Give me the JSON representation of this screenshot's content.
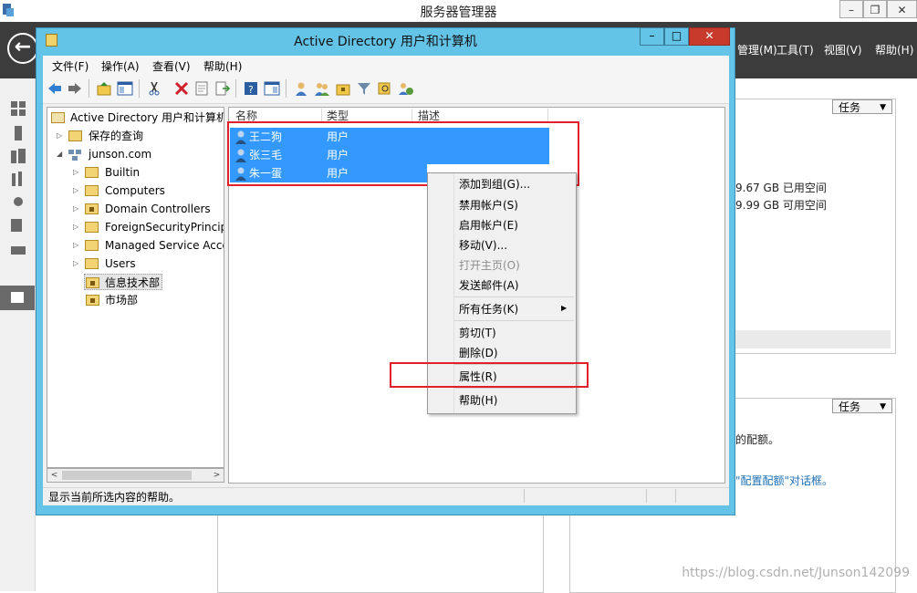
{
  "server_manager": {
    "title": "服务器管理器",
    "menus": [
      "管理(M)",
      "工具(T)",
      "视图(V)",
      "帮助(H)"
    ],
    "task_button": "任务",
    "disk_used": "9.67 GB 已用空间",
    "disk_free": "9.99 GB 可用空间",
    "quota_text_1": "的配额。",
    "quota_text_2": "\"配置配额\"对话框。"
  },
  "ad_window": {
    "title": "Active Directory 用户和计算机",
    "menus": [
      "文件(F)",
      "操作(A)",
      "查看(V)",
      "帮助(H)"
    ],
    "toolbar_icons": [
      "back-icon",
      "forward-icon",
      "up-folder-icon",
      "show-tree-icon",
      "cut-icon",
      "delete-icon",
      "properties-icon",
      "export-icon",
      "help-icon",
      "help-pane-icon",
      "new-user-icon",
      "new-group-icon",
      "new-ou-icon",
      "filter-icon",
      "find-icon",
      "add-to-group-icon"
    ],
    "tree": {
      "root": "Active Directory 用户和计算机",
      "saved_queries": "保存的查询",
      "domain": "junson.com",
      "children": [
        "Builtin",
        "Computers",
        "Domain Controllers",
        "ForeignSecurityPrincipals",
        "Managed Service Accounts",
        "Users",
        "信息技术部",
        "市场部"
      ]
    },
    "list": {
      "columns": [
        "名称",
        "类型",
        "描述"
      ],
      "rows": [
        {
          "name": "王二狗",
          "type": "用户"
        },
        {
          "name": "张三毛",
          "type": "用户"
        },
        {
          "name": "朱一蛋",
          "type": "用户"
        }
      ]
    },
    "status": "显示当前所选内容的帮助。"
  },
  "context_menu": {
    "items": [
      "添加到组(G)...",
      "禁用帐户(S)",
      "启用帐户(E)",
      "移动(V)...",
      "打开主页(O)",
      "发送邮件(A)",
      "所有任务(K)",
      "剪切(T)",
      "删除(D)",
      "属性(R)",
      "帮助(H)"
    ],
    "disabled": [
      "打开主页(O)"
    ]
  },
  "colors": {
    "selection": "#3399ff",
    "title_bar": "#64c4e8",
    "annotation": "#e0202a",
    "close_button": "#c83b2c"
  },
  "watermark": "https://blog.csdn.net/Junson142099"
}
